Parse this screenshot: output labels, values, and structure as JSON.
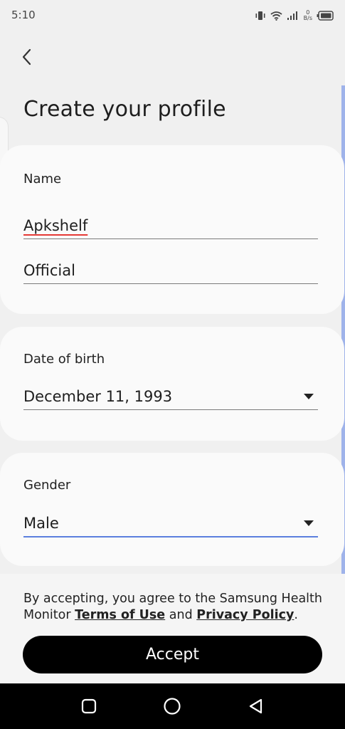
{
  "status_bar": {
    "time": "5:10",
    "net_speed_value": "0",
    "net_speed_unit": "B/s",
    "icons": [
      "vibrate-icon",
      "wifi-icon",
      "signal-icon",
      "battery-icon"
    ]
  },
  "header": {
    "back_icon": "chevron-left-icon",
    "title": "Create your profile"
  },
  "name_card": {
    "label": "Name",
    "first_name": "Apkshelf",
    "last_name": "Official"
  },
  "dob_card": {
    "label": "Date of birth",
    "value": "December 11, 1993"
  },
  "gender_card": {
    "label": "Gender",
    "value": "Male"
  },
  "consent": {
    "text_before": "By accepting, you agree to the Samsung Health Monitor ",
    "terms_link": "Terms of Use",
    "text_middle": " and ",
    "privacy_link": "Privacy Policy",
    "text_after": "."
  },
  "accept_button": {
    "label": "Accept"
  },
  "colors": {
    "background": "#f0f0f0",
    "card": "#fafafa",
    "focus_underline": "#5b7fde",
    "spellcheck": "#e53935",
    "button": "#000000"
  }
}
